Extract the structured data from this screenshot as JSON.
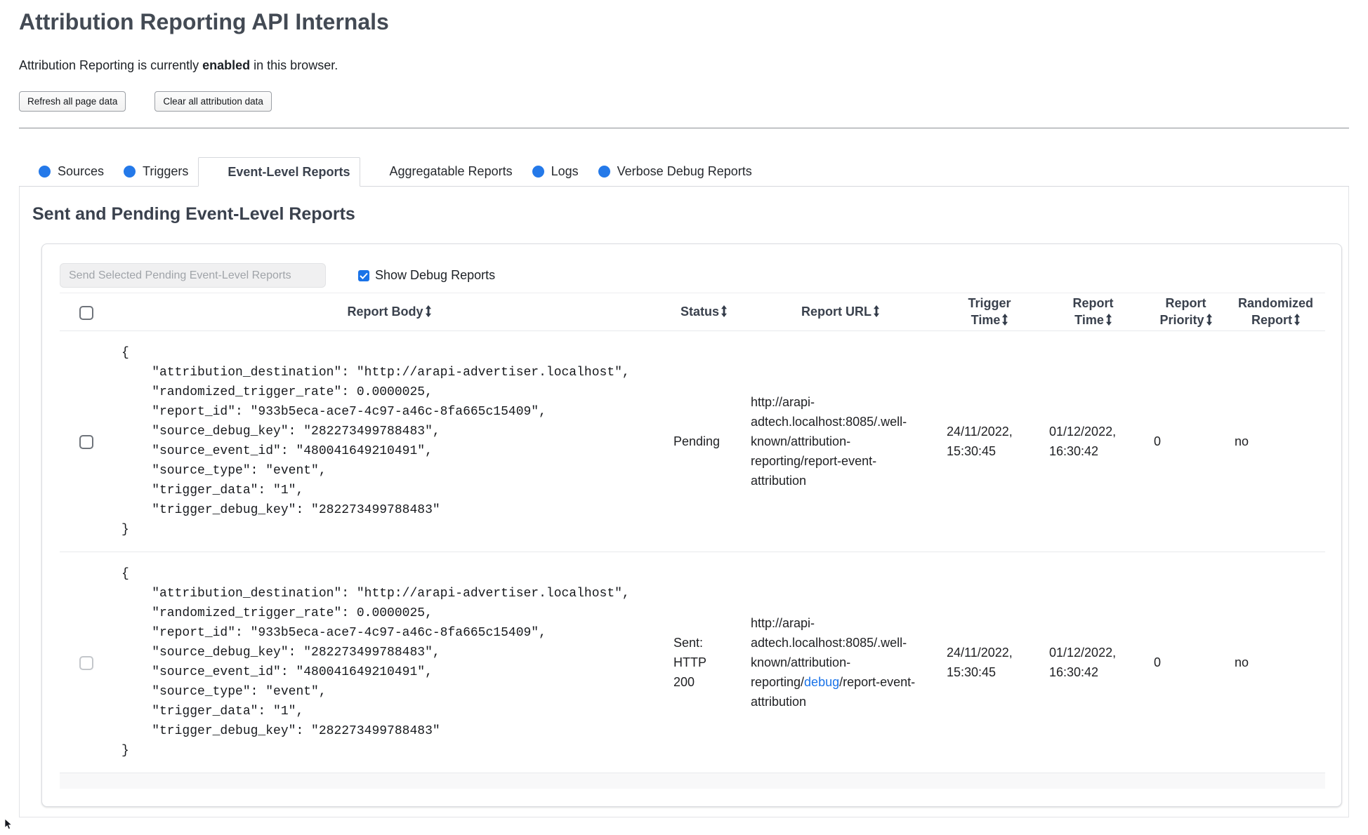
{
  "page": {
    "title": "Attribution Reporting API Internals"
  },
  "status_line": {
    "prefix": "Attribution Reporting is currently ",
    "highlight": "enabled",
    "suffix": " in this browser."
  },
  "toolbar": {
    "refresh": "Refresh all page data",
    "clear": "Clear all attribution data"
  },
  "tabs": [
    {
      "label": "Sources",
      "dot": true,
      "active": false
    },
    {
      "label": "Triggers",
      "dot": true,
      "active": false
    },
    {
      "label": "Event-Level Reports",
      "dot": false,
      "active": true
    },
    {
      "label": "Aggregatable Reports",
      "dot": false,
      "active": false
    },
    {
      "label": "Logs",
      "dot": true,
      "active": false
    },
    {
      "label": "Verbose Debug Reports",
      "dot": true,
      "active": false
    }
  ],
  "panel": {
    "heading": "Sent and Pending Event-Level Reports",
    "send_button": "Send Selected Pending Event-Level Reports",
    "show_debug": "Show Debug Reports",
    "show_debug_checked": true,
    "sort_icon": "↕",
    "columns": [
      "Report Body",
      "Status",
      "Report URL",
      "Trigger\nTime",
      "Report\nTime",
      "Report\nPriority",
      "Randomized\nReport"
    ],
    "rows": [
      {
        "selected": false,
        "selectable": true,
        "report_body": "{\n    \"attribution_destination\": \"http://arapi-advertiser.localhost\",\n    \"randomized_trigger_rate\": 0.0000025,\n    \"report_id\": \"933b5eca-ace7-4c97-a46c-8fa665c15409\",\n    \"source_debug_key\": \"282273499788483\",\n    \"source_event_id\": \"480041649210491\",\n    \"source_type\": \"event\",\n    \"trigger_data\": \"1\",\n    \"trigger_debug_key\": \"282273499788483\"\n}",
        "status": "Pending",
        "url_before": "http://arapi-adtech.localhost:8085/.well-known/attribution-reporting/report-event-attribution",
        "url_link": "",
        "url_after": "",
        "trigger_time": "24/11/2022, 15:30:45",
        "report_time": "01/12/2022, 16:30:42",
        "report_priority": "0",
        "randomized_report": "no"
      },
      {
        "selected": false,
        "selectable": false,
        "report_body": "{\n    \"attribution_destination\": \"http://arapi-advertiser.localhost\",\n    \"randomized_trigger_rate\": 0.0000025,\n    \"report_id\": \"933b5eca-ace7-4c97-a46c-8fa665c15409\",\n    \"source_debug_key\": \"282273499788483\",\n    \"source_event_id\": \"480041649210491\",\n    \"source_type\": \"event\",\n    \"trigger_data\": \"1\",\n    \"trigger_debug_key\": \"282273499788483\"\n}",
        "status": "Sent: HTTP 200",
        "url_before": "http://arapi-adtech.localhost:8085/.well-known/attribution-reporting/",
        "url_link": "debug",
        "url_after": "/report-event-attribution",
        "trigger_time": "24/11/2022, 15:30:45",
        "report_time": "01/12/2022, 16:30:42",
        "report_priority": "0",
        "randomized_report": "no"
      }
    ]
  },
  "colors": {
    "accent": "#1a73e8"
  }
}
